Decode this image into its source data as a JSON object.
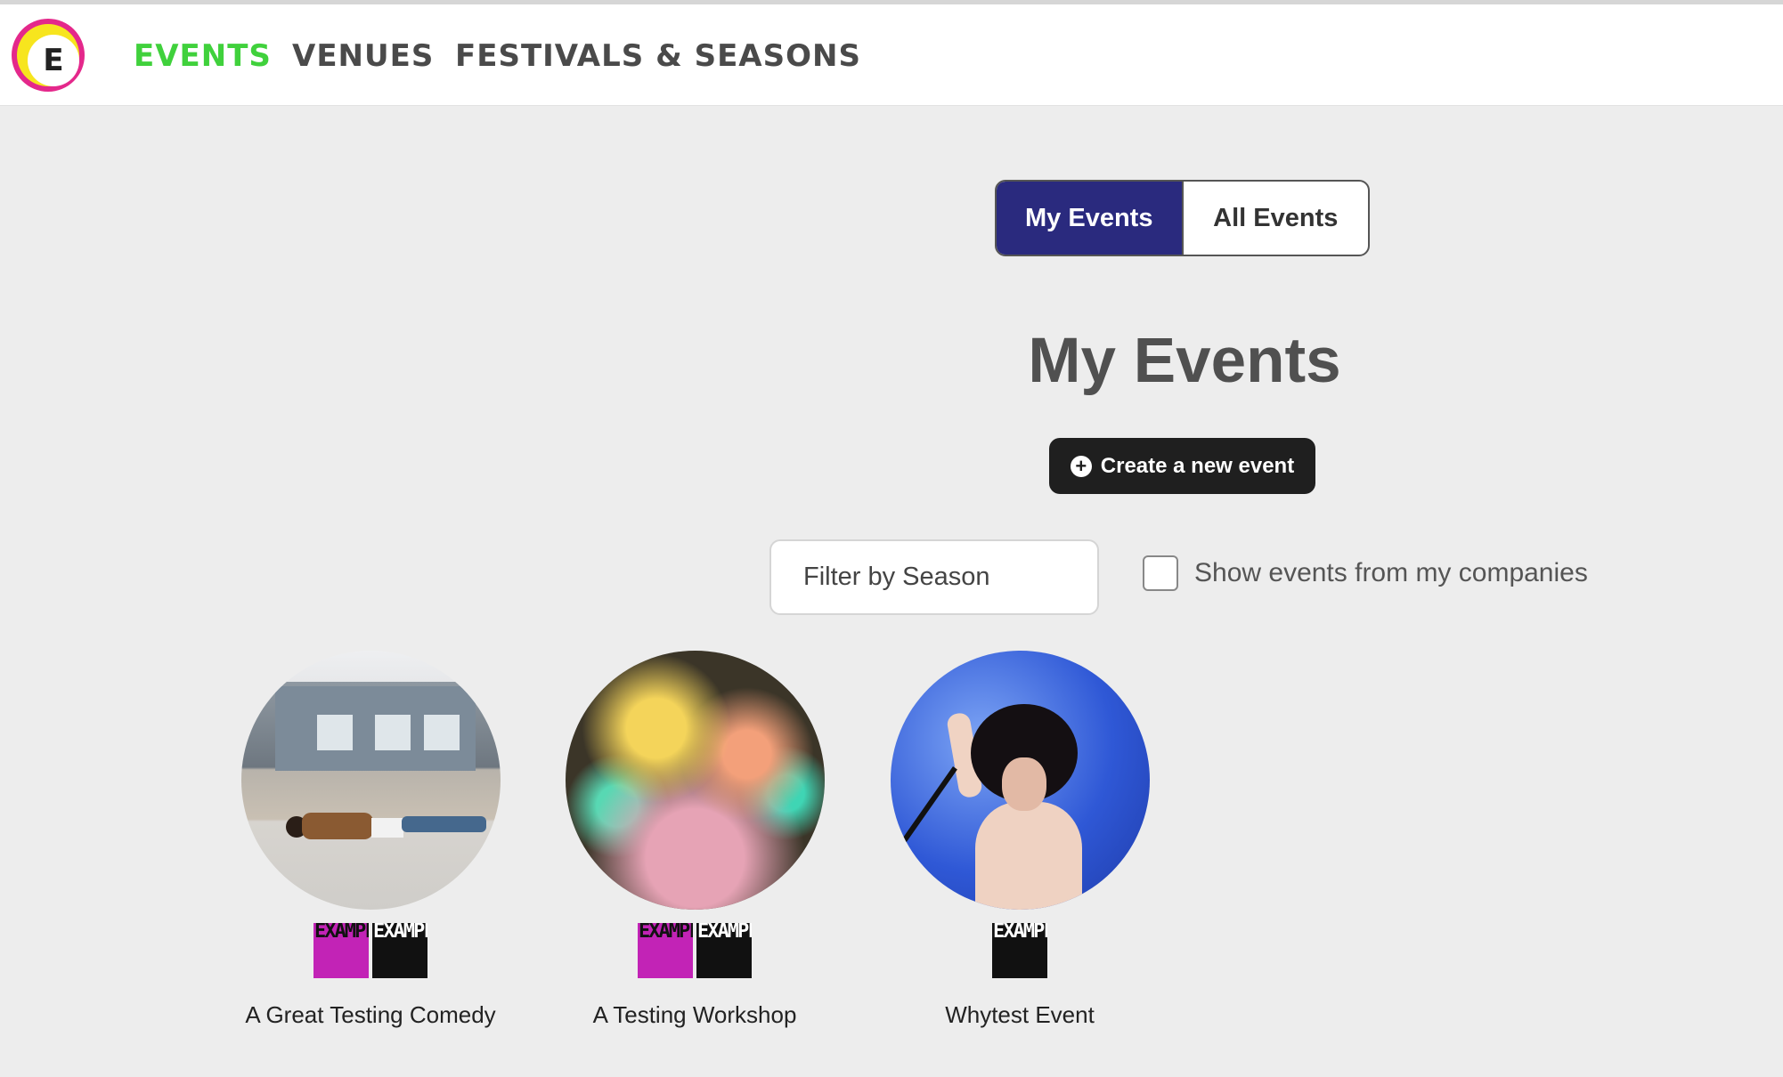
{
  "nav": {
    "logo_letter": "E",
    "links": [
      "EVENTS",
      "VENUES",
      "FESTIVALS & SEASONS"
    ],
    "active": "EVENTS",
    "colors": {
      "active": "#40d13c",
      "inactive": "#4a4a4a"
    }
  },
  "toggle": {
    "my_events": "My Events",
    "all_events": "All Events",
    "selected": "My Events",
    "selected_color": "#2a2a7e"
  },
  "page_title": "My Events",
  "create_button": {
    "icon": "plus-circle-icon",
    "label": "Create a new event"
  },
  "filter": {
    "placeholder": "Filter by Season"
  },
  "companies_checkbox": {
    "label": "Show events from my companies",
    "checked": false
  },
  "events": [
    {
      "title": "A Great Testing Comedy",
      "badges": [
        "magenta",
        "black"
      ],
      "badge_text": "EXAMPLEFESTIVAL"
    },
    {
      "title": "A Testing Workshop",
      "badges": [
        "magenta",
        "black"
      ],
      "badge_text": "EXAMPLEFESTIVAL"
    },
    {
      "title": "Whytest Event",
      "badges": [
        "black"
      ],
      "badge_text": "EXAMPLEFESTIVAL"
    }
  ]
}
